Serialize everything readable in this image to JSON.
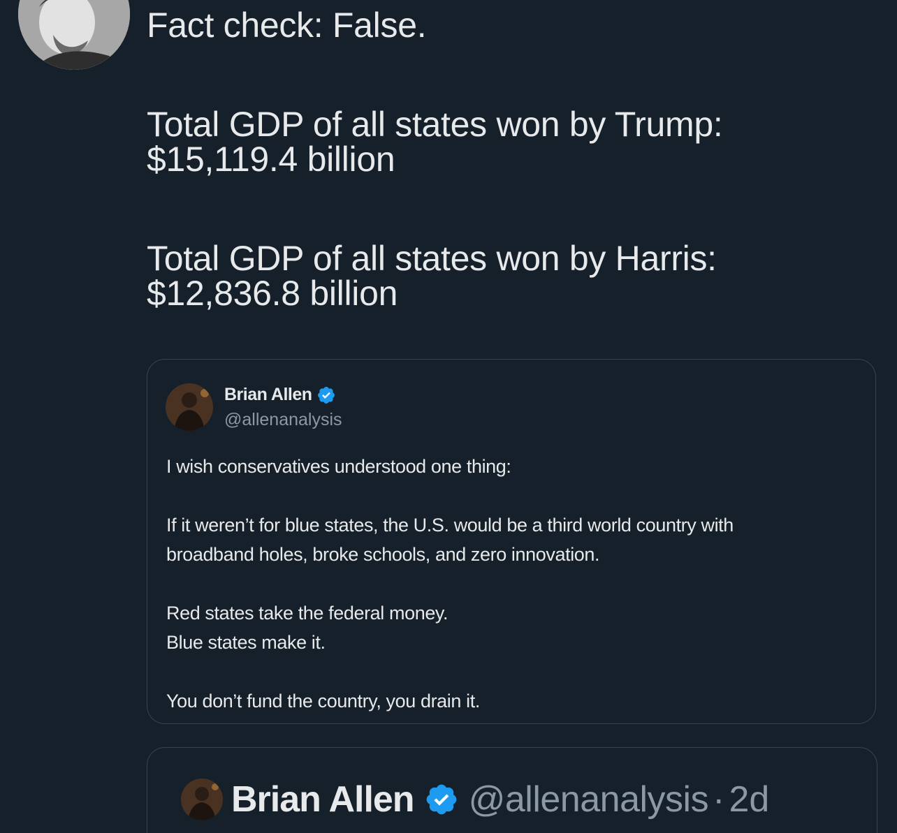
{
  "main_tweet": {
    "lines": [
      "Fact check: False.",
      "Total GDP of all states won by Trump:",
      "$15,119.4 billion",
      "Total GDP of all states won by Harris:",
      "$12,836.8 billion"
    ]
  },
  "quoted_tweet": {
    "author_name": "Brian Allen",
    "handle": "@allenanalysis",
    "verified": true,
    "body": [
      "I wish conservatives understood one thing:",
      "If it weren’t for blue states, the U.S. would be a third world country with",
      "broadband holes, broke schools, and zero innovation.",
      "Red states take the federal money.",
      "Blue states make it.",
      "You don’t fund the country, you drain it."
    ]
  },
  "second_card": {
    "author_name": "Brian Allen",
    "handle": "@allenanalysis",
    "separator": "·",
    "time": "2d",
    "verified": true
  },
  "colors": {
    "background": "#15202b",
    "text": "#e7e9ea",
    "secondary_text": "#8b98a5",
    "border": "#38444d",
    "verified_blue": "#1d9bf0"
  }
}
